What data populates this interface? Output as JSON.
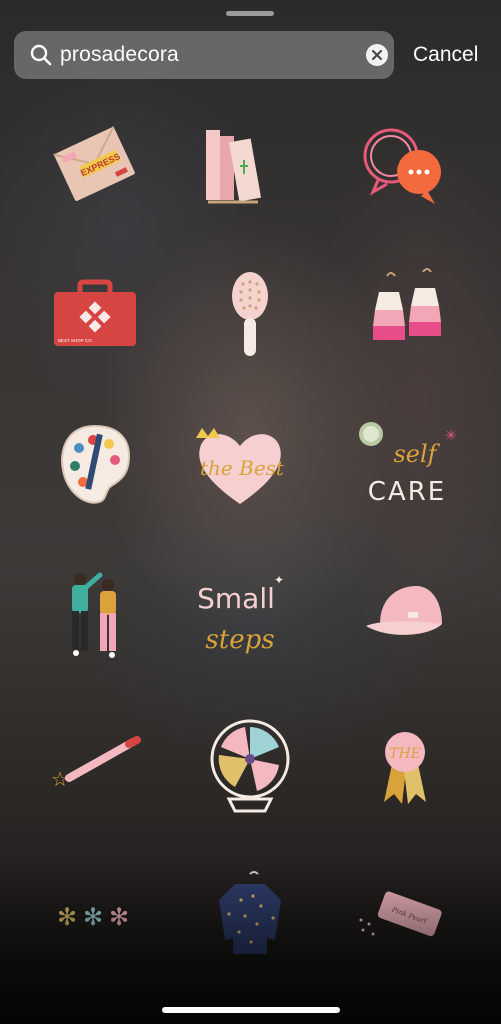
{
  "search": {
    "query": "prosadecora",
    "cancel_label": "Cancel"
  },
  "stickers": [
    {
      "name": "express-envelope-sticker",
      "text": "EXPRESS"
    },
    {
      "name": "books-stack-sticker"
    },
    {
      "name": "speech-bubbles-sticker"
    },
    {
      "name": "first-aid-kit-sticker",
      "text": "BEST SHOP CO."
    },
    {
      "name": "hairbrush-sticker"
    },
    {
      "name": "tassel-earrings-sticker"
    },
    {
      "name": "paint-palette-sticker"
    },
    {
      "name": "the-best-heart-sticker",
      "text": "the Best"
    },
    {
      "name": "self-care-sticker",
      "line1": "self",
      "line2": "CARE"
    },
    {
      "name": "dancing-couple-sticker"
    },
    {
      "name": "small-steps-sticker",
      "line1": "Small",
      "line2": "steps"
    },
    {
      "name": "baseball-cap-sticker"
    },
    {
      "name": "pencil-star-sticker"
    },
    {
      "name": "desk-fan-sticker"
    },
    {
      "name": "the-award-ribbon-sticker",
      "text": "THE"
    },
    {
      "name": "flower-asterisks-sticker"
    },
    {
      "name": "polka-dot-sweater-sticker"
    },
    {
      "name": "eraser-sticker",
      "text": "Pink Pearl"
    }
  ],
  "colors": {
    "search_bg": "rgba(200,200,200,0.38)",
    "text": "#ffffff",
    "accent_pink": "#f2b8c0",
    "accent_mustard": "#d9a23b",
    "accent_red": "#d64541"
  },
  "icons": {
    "search": "search-icon",
    "clear": "clear-icon"
  }
}
